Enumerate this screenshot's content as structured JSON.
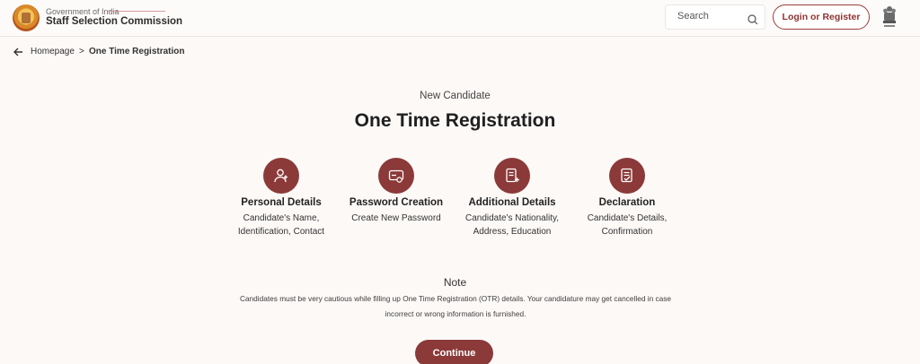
{
  "header": {
    "gov_label": "Government of India",
    "org_name": "Staff Selection Commission",
    "search": {
      "placeholder": "Search",
      "icon": "search-icon"
    },
    "login_label": "Login or Register",
    "emblem_icon": "national-emblem-icon",
    "logo_icon": "ssc-logo-icon"
  },
  "breadcrumb": {
    "back_icon": "arrow-left-icon",
    "home": "Homepage",
    "separator": ">",
    "current": "One Time Registration"
  },
  "main": {
    "eyebrow": "New Candidate",
    "title": "One Time Registration",
    "steps": [
      {
        "icon": "user-add-icon",
        "title": "Personal Details",
        "desc": "Candidate's Name, Identification, Contact"
      },
      {
        "icon": "password-card-icon",
        "title": "Password Creation",
        "desc": "Create New Password"
      },
      {
        "icon": "document-add-icon",
        "title": "Additional Details",
        "desc": "Candidate's Nationality, Address, Education"
      },
      {
        "icon": "document-check-icon",
        "title": "Declaration",
        "desc": "Candidate's Details, Confirmation"
      }
    ],
    "note": {
      "title": "Note",
      "text": "Candidates must be very cautious while filling up One Time Registration (OTR) details. Your candidature may get cancelled in case incorrect or wrong information is furnished."
    },
    "continue_label": "Continue"
  },
  "colors": {
    "accent": "#8b3a39",
    "background": "#fcf9f7",
    "text": "#222222"
  }
}
